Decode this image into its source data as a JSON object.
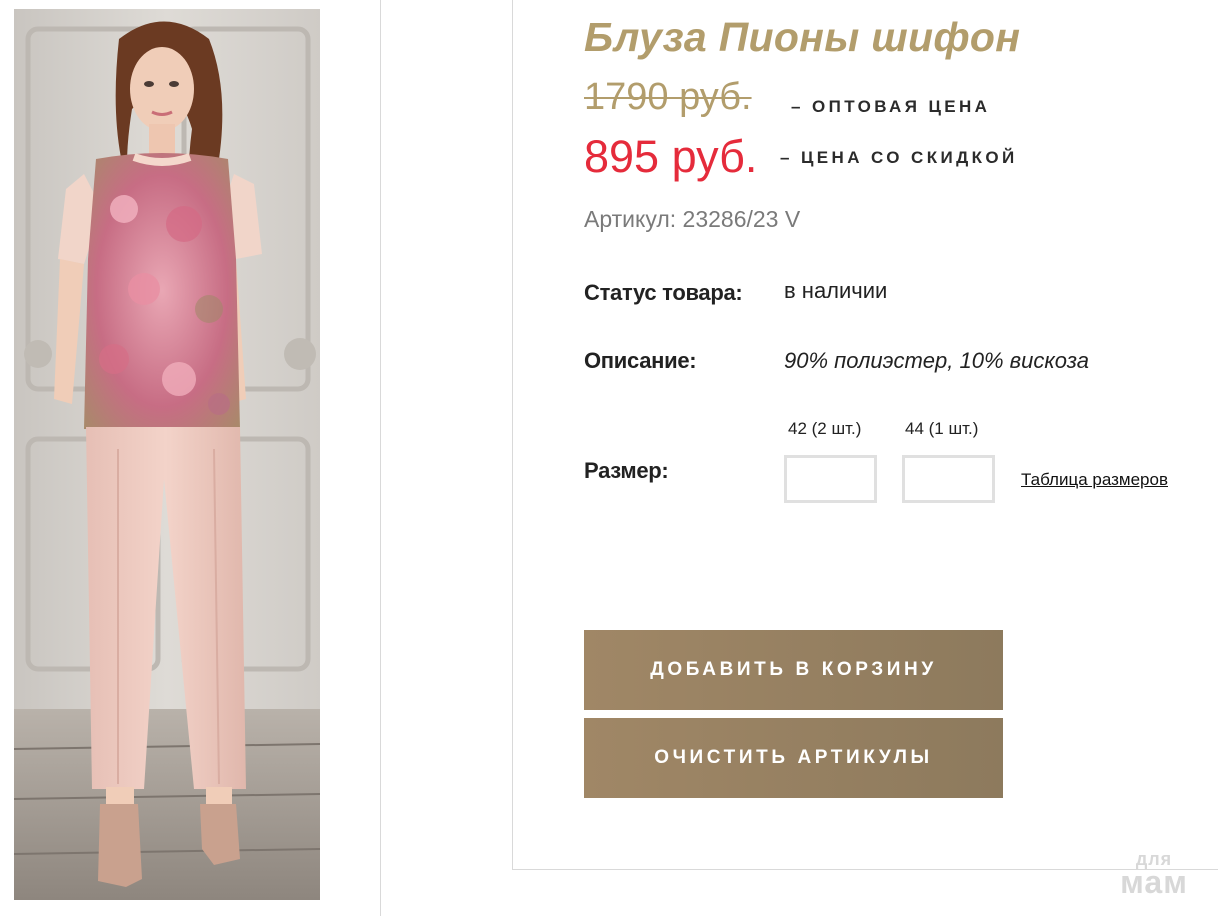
{
  "product": {
    "title": "Блуза Пионы шифон",
    "old_price": "1790 руб.",
    "old_price_label": "– ОПТОВАЯ ЦЕНА",
    "new_price": "895 руб.",
    "new_price_label": "– ЦЕНА СО СКИДКОЙ",
    "article": "Артикул: 23286/23 V"
  },
  "details": {
    "status_label": "Статус товара:",
    "status_value": "в наличии",
    "description_label": "Описание:",
    "description_value": "90% полиэстер, 10% вискоза"
  },
  "sizes": {
    "label": "Размер:",
    "options": [
      {
        "caption": "42 (2 шт.)",
        "quantity": ""
      },
      {
        "caption": "44 (1 шт.)",
        "quantity": ""
      }
    ],
    "size_table_link": "Таблица размеров"
  },
  "actions": {
    "add_to_cart": "ДОБАВИТЬ В КОРЗИНУ",
    "clear_articles": "ОЧИСТИТЬ АРТИКУЛЫ"
  },
  "watermark": {
    "top": "для",
    "bottom": "мам"
  },
  "colors": {
    "accent_gold": "#b29d6c",
    "sale_red": "#e52b3b",
    "button_brown": "#a08766"
  }
}
